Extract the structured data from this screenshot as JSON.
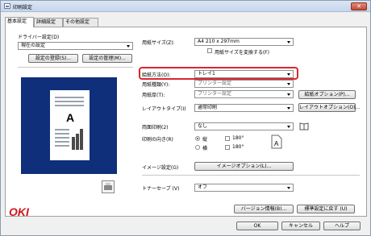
{
  "window": {
    "title": "印刷設定",
    "close_label": "✕"
  },
  "tabs": [
    {
      "label": "基本設定"
    },
    {
      "label": "詳細設定"
    },
    {
      "label": "その他設定"
    }
  ],
  "driver_settings": {
    "label": "ドライバー設定(D)",
    "value": "現在の設定",
    "save_button": "設定の登録(S)...",
    "manage_button": "設定の管理(M)..."
  },
  "paper_size": {
    "label": "用紙サイズ(Z):",
    "value": "A4 210 x 297mm",
    "edit_checkbox": "用紙サイズを変換する(F)"
  },
  "paper_feed": {
    "label": "給紙方法(O):",
    "value": "トレイ1"
  },
  "paper_type": {
    "label": "用紙種類(Y):",
    "value": "プリンター設定"
  },
  "paper_weight": {
    "label": "用紙厚(T):",
    "value": "プリンター設定",
    "options_button": "給紙オプション(P)..."
  },
  "layout": {
    "label": "レイアウトタイプ(I)",
    "value": "通常印刷",
    "options_button": "レイアウトオプション(O)..."
  },
  "duplex": {
    "label": "両面印刷(2)",
    "value": "なし"
  },
  "orientation": {
    "label": "印刷の向き(R)",
    "portrait": "縦",
    "landscape": "横",
    "rotate_checkbox_1": "180°",
    "rotate_checkbox_2": "180°"
  },
  "image_settings": {
    "label": "イメージ設定(G)",
    "button": "イメージオプション(L)..."
  },
  "toner_save": {
    "label": "トナーセーブ (V)",
    "value": "オフ"
  },
  "footer": {
    "logo": "OKI",
    "version_button": "バージョン情報(B)...",
    "default_button": "標準設定に戻す (U)",
    "ok_button": "OK",
    "cancel_button": "キャンセル",
    "help_button": "ヘルプ"
  },
  "preview": {
    "letter": "A"
  },
  "colors": {
    "accent_highlight": "#d9262e",
    "preview_bg": "#102f7a",
    "logo": "#d0161d"
  }
}
